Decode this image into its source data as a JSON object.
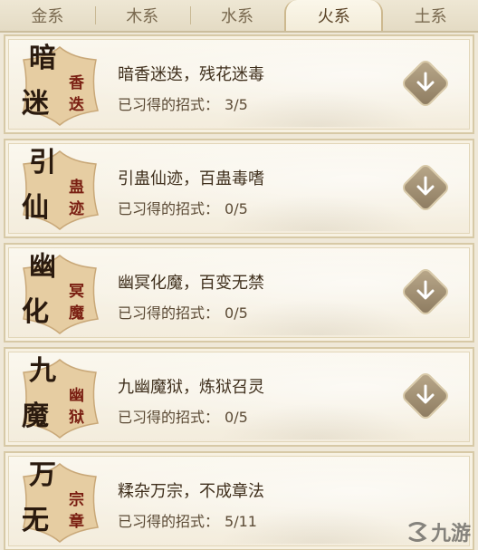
{
  "tabs": [
    {
      "label": "金系",
      "active": false
    },
    {
      "label": "木系",
      "active": false
    },
    {
      "label": "水系",
      "active": false
    },
    {
      "label": "火系",
      "active": true
    },
    {
      "label": "土系",
      "active": false
    }
  ],
  "skills": [
    {
      "emblem": {
        "big1": "暗",
        "big2": "迷",
        "small1": "香",
        "small2": "迭"
      },
      "title": "暗香迷迭，残花迷毒",
      "progress_label": "已习得的招式：",
      "progress": "3/5"
    },
    {
      "emblem": {
        "big1": "引",
        "big2": "仙",
        "small1": "蛊",
        "small2": "迹"
      },
      "title": "引蛊仙迹，百蛊毒嗜",
      "progress_label": "已习得的招式：",
      "progress": "0/5"
    },
    {
      "emblem": {
        "big1": "幽",
        "big2": "化",
        "small1": "冥",
        "small2": "魔"
      },
      "title": "幽冥化魔，百变无禁",
      "progress_label": "已习得的招式：",
      "progress": "0/5"
    },
    {
      "emblem": {
        "big1": "九",
        "big2": "魔",
        "small1": "幽",
        "small2": "狱"
      },
      "title": "九幽魔狱，炼狱召灵",
      "progress_label": "已习得的招式：",
      "progress": "0/5"
    },
    {
      "emblem": {
        "big1": "万",
        "big2": "无",
        "small1": "宗",
        "small2": "章"
      },
      "title": "糅杂万宗，不成章法",
      "progress_label": "已习得的招式：",
      "progress": "5/11"
    }
  ],
  "watermark": {
    "text": "九游",
    "icon": "jiuyou-logo-icon"
  },
  "colors": {
    "background": "#efe8d8",
    "emblem_plate": "#e4caa0",
    "expand_button": "#9c8a6c"
  }
}
